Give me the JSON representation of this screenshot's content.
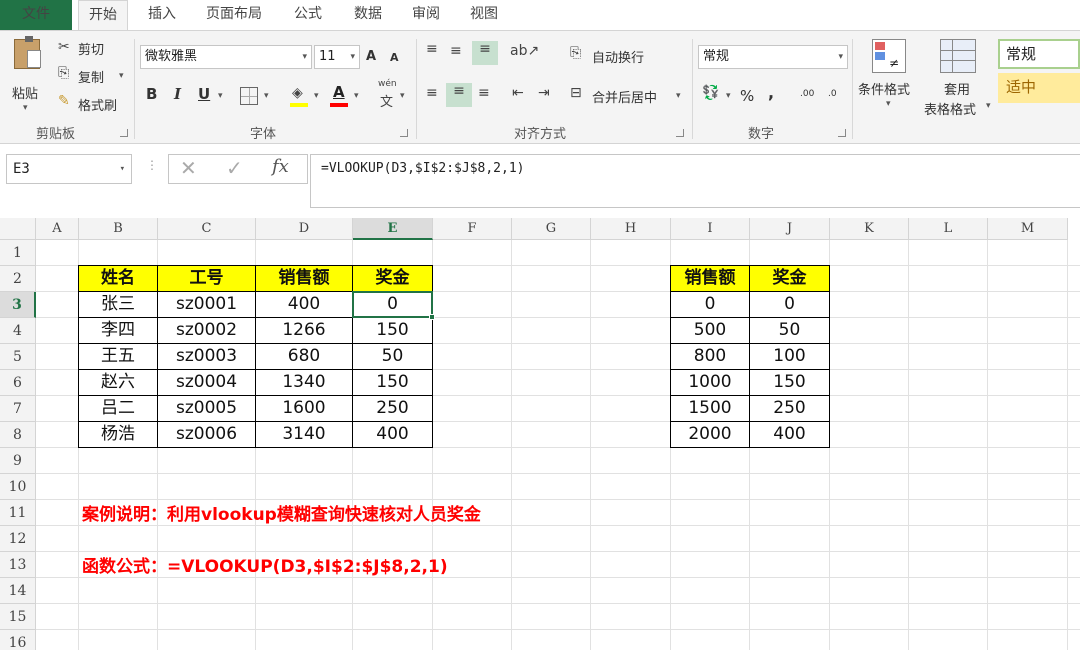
{
  "tabs": [
    "文件",
    "开始",
    "插入",
    "页面布局",
    "公式",
    "数据",
    "审阅",
    "视图"
  ],
  "ribbon": {
    "clipboard": {
      "paste": "粘贴",
      "cut": "剪切",
      "copy": "复制",
      "format_painter": "格式刷",
      "group": "剪贴板"
    },
    "font": {
      "name": "微软雅黑",
      "size": "11",
      "grow": "A",
      "shrink": "A",
      "bold": "B",
      "italic": "I",
      "underline": "U",
      "font_color_glyph": "A",
      "phonetic": "wén",
      "phonetic_char": "文",
      "group": "字体"
    },
    "alignment": {
      "wrap": "自动换行",
      "merge": "合并后居中",
      "group": "对齐方式"
    },
    "number": {
      "format": "常规",
      "percent": "%",
      "comma": ",",
      "inc_dec": ".00",
      "dec_dec": ".0",
      "group": "数字"
    },
    "styles": {
      "conditional": "条件格式",
      "table_format_1": "套用",
      "table_format_2": "表格格式",
      "style_normal": "常规",
      "style_neutral": "适中"
    }
  },
  "formula_bar": {
    "name_box": "E3",
    "fx": "fx",
    "formula": "=VLOOKUP(D3,$I$2:$J$8,2,1)"
  },
  "columns": [
    "A",
    "B",
    "C",
    "D",
    "E",
    "F",
    "G",
    "H",
    "I",
    "J",
    "K",
    "L",
    "M"
  ],
  "rows": [
    "1",
    "2",
    "3",
    "4",
    "5",
    "6",
    "7",
    "8",
    "9",
    "10",
    "11",
    "12",
    "13",
    "14",
    "15",
    "16"
  ],
  "table1": {
    "headers": [
      "姓名",
      "工号",
      "销售额",
      "奖金"
    ],
    "rows": [
      [
        "张三",
        "sz0001",
        "400",
        "0"
      ],
      [
        "李四",
        "sz0002",
        "1266",
        "150"
      ],
      [
        "王五",
        "sz0003",
        "680",
        "50"
      ],
      [
        "赵六",
        "sz0004",
        "1340",
        "150"
      ],
      [
        "吕二",
        "sz0005",
        "1600",
        "250"
      ],
      [
        "杨浩",
        "sz0006",
        "3140",
        "400"
      ]
    ]
  },
  "table2": {
    "headers": [
      "销售额",
      "奖金"
    ],
    "rows": [
      [
        "0",
        "0"
      ],
      [
        "500",
        "50"
      ],
      [
        "800",
        "100"
      ],
      [
        "1000",
        "150"
      ],
      [
        "1500",
        "250"
      ],
      [
        "2000",
        "400"
      ]
    ]
  },
  "notes": {
    "description": "案例说明：利用vlookup模糊查询快速核对人员奖金",
    "formula_note": "函数公式：=VLOOKUP(D3,$I$2:$J$8,2,1)"
  },
  "colors": {
    "accent": "#217346",
    "header_fill": "#ffff00",
    "note_text": "#ff0000"
  }
}
